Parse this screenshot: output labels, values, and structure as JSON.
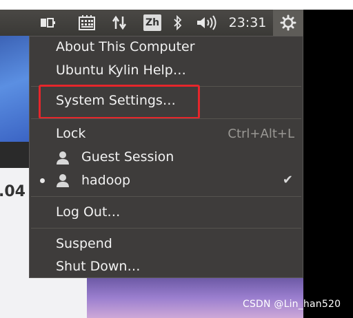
{
  "panel": {
    "indicators": [
      {
        "icon": "battery-icon"
      },
      {
        "icon": "keyboard-icon"
      },
      {
        "icon": "network-transfer-icon"
      },
      {
        "icon": "input-method-icon",
        "label": "Zh"
      },
      {
        "icon": "bluetooth-icon"
      },
      {
        "icon": "volume-icon"
      }
    ],
    "clock": "23:31",
    "session_icon": "gear-icon"
  },
  "background": {
    "window_title_fragment": ".04"
  },
  "menu": {
    "about": "About This Computer",
    "help": "Ubuntu Kylin Help…",
    "settings": "System Settings…",
    "lock": "Lock",
    "lock_shortcut": "Ctrl+Alt+L",
    "guest": "Guest Session",
    "user": "hadoop",
    "logout": "Log Out…",
    "suspend": "Suspend",
    "shutdown": "Shut Down…"
  },
  "watermark": "CSDN @Lin_han520",
  "colors": {
    "panel": "#3a3936",
    "menu_bg": "#3e3c3b",
    "highlight_border": "#e5262b"
  }
}
